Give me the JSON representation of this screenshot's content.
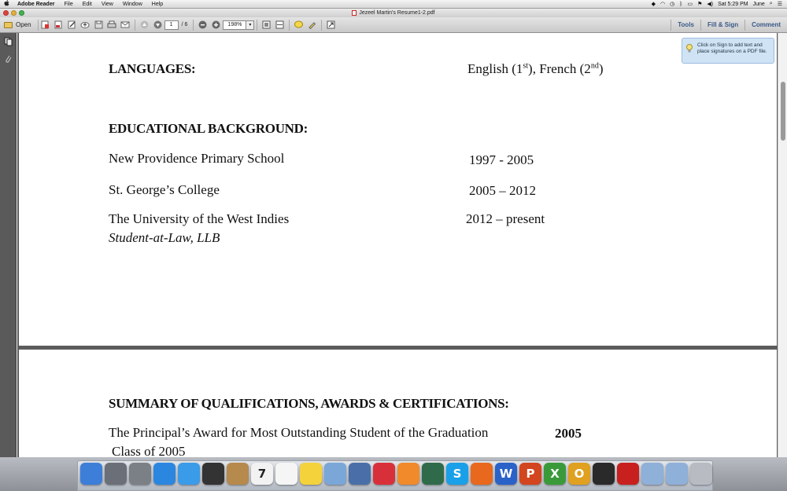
{
  "menubar": {
    "apple": "",
    "app_name": "Adobe Reader",
    "items": [
      "File",
      "Edit",
      "View",
      "Window",
      "Help"
    ],
    "clock": "Sat 5:29 PM",
    "user": "June"
  },
  "window": {
    "title": "Jezeel Martin's Resume1-2.pdf"
  },
  "toolbar": {
    "open_label": "Open",
    "page_current": "1",
    "page_total": "/ 6",
    "zoom": "198%",
    "tools_label": "Tools",
    "fill_sign_label": "Fill & Sign",
    "comment_label": "Comment"
  },
  "tooltip": {
    "text": "Click on Sign to add text and place signatures on a PDF file."
  },
  "document": {
    "languages_heading": "LANGUAGES:",
    "lang1": "English (1",
    "lang1_sup": "st",
    "lang_mid": "), French (2",
    "lang2_sup": "nd",
    "lang_end": ")",
    "education_heading": "EDUCATIONAL BACKGROUND:",
    "schools": [
      {
        "name": "New Providence Primary School",
        "years": "1997 - 2005"
      },
      {
        "name": "St. George’s College",
        "years": "2005 – 2012"
      },
      {
        "name": "The University of the West Indies",
        "years": "2012 – present"
      }
    ],
    "degree": "Student-at-Law, LLB",
    "summary_heading": "SUMMARY OF QUALIFICATIONS, AWARDS & CERTIFICATIONS:",
    "award_line1": "The Principal’s Award for Most Outstanding Student of the Graduation",
    "award_year": "2005",
    "award_line2": "Class of 2005"
  },
  "dock": {
    "apps": [
      {
        "name": "finder",
        "color": "#3d7ed8",
        "glyph": ""
      },
      {
        "name": "launchpad",
        "color": "#6a6f78",
        "glyph": ""
      },
      {
        "name": "system-preferences",
        "color": "#7b7f86",
        "glyph": ""
      },
      {
        "name": "app-store",
        "color": "#2b86e0",
        "glyph": ""
      },
      {
        "name": "safari",
        "color": "#3a9be8",
        "glyph": ""
      },
      {
        "name": "dashboard",
        "color": "#333333",
        "glyph": ""
      },
      {
        "name": "address-book",
        "color": "#b58a4c",
        "glyph": ""
      },
      {
        "name": "calendar",
        "color": "#f2f2f2",
        "glyph": "7"
      },
      {
        "name": "reminders",
        "color": "#f5f5f5",
        "glyph": ""
      },
      {
        "name": "stickies",
        "color": "#f3d23c",
        "glyph": ""
      },
      {
        "name": "preview",
        "color": "#7aa7d8",
        "glyph": ""
      },
      {
        "name": "iphoto",
        "color": "#4a6fa8",
        "glyph": ""
      },
      {
        "name": "itunes",
        "color": "#d8303a",
        "glyph": ""
      },
      {
        "name": "ibooks",
        "color": "#f08a2a",
        "glyph": ""
      },
      {
        "name": "photo-booth",
        "color": "#2f6b4a",
        "glyph": ""
      },
      {
        "name": "skype",
        "color": "#1aa0e8",
        "glyph": "S"
      },
      {
        "name": "firefox",
        "color": "#e8681e",
        "glyph": ""
      },
      {
        "name": "word",
        "color": "#2a62c8",
        "glyph": "W"
      },
      {
        "name": "powerpoint",
        "color": "#d2451e",
        "glyph": "P"
      },
      {
        "name": "excel",
        "color": "#3a9a3a",
        "glyph": "X"
      },
      {
        "name": "outlook",
        "color": "#e0a020",
        "glyph": "O"
      },
      {
        "name": "printer",
        "color": "#2a2a2a",
        "glyph": ""
      },
      {
        "name": "adobe-reader",
        "color": "#c8201e",
        "glyph": ""
      },
      {
        "name": "applications-folder",
        "color": "#8fb0d8",
        "glyph": ""
      },
      {
        "name": "documents-folder",
        "color": "#8fb0d8",
        "glyph": ""
      },
      {
        "name": "trash",
        "color": "#b8bcc2",
        "glyph": ""
      }
    ]
  }
}
